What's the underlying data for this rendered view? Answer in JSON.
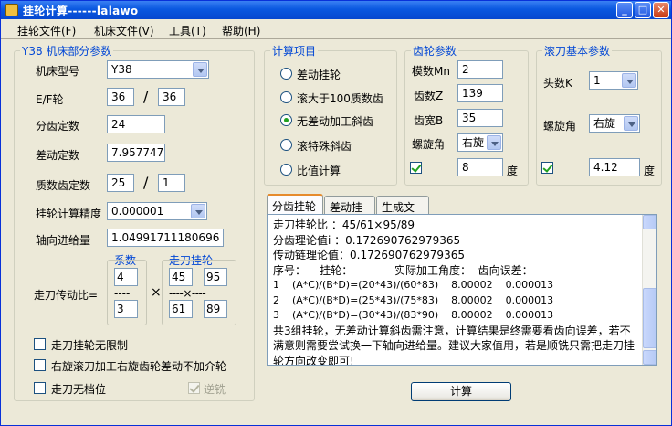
{
  "window": {
    "title": "挂轮计算------lalawo",
    "min_glyph": "_",
    "max_glyph": "□",
    "close_glyph": "✕"
  },
  "menu": {
    "items": [
      "挂轮文件(F)",
      "机床文件(V)",
      "工具(T)",
      "帮助(H)"
    ]
  },
  "machine": {
    "legend": "Y38 机床部分参数",
    "model_label": "机床型号",
    "model_value": "Y38",
    "ef_label": "E/F轮",
    "e_value": "36",
    "f_value": "36",
    "slash": "/",
    "indexing_const_label": "分齿定数",
    "indexing_const_value": "24",
    "diff_const_label": "差动定数",
    "diff_const_value": "7.957747",
    "prime_const_label": "质数齿定数",
    "prime_a_value": "25",
    "prime_b_value": "1",
    "precision_label": "挂轮计算精度",
    "precision_value": "0.000001",
    "axial_feed_label": "轴向进给量",
    "axial_feed_value": "1.04991711180696",
    "coef_title": "系数",
    "feed_gear_title": "走刀挂轮",
    "feed_ratio_label": "走刀传动比=",
    "coef_top": "4",
    "coef_sep": "----",
    "coef_bottom": "3",
    "times_sign": "×",
    "gear_a": "45",
    "gear_b": "95",
    "gear_c": "61",
    "gear_d": "89",
    "gear_sep": "----×----",
    "opt_no_limit": "走刀挂轮无限制",
    "opt_right_hob": "右旋滚刀加工右旋齿轮差动不加介轮",
    "opt_no_gear": "走刀无档位",
    "opt_climb": "逆铣"
  },
  "calc_items": {
    "legend": "计算项目",
    "options": [
      "差动挂轮",
      "滚大于100质数齿",
      "无差动加工斜齿",
      "滚特殊斜齿",
      "比值计算"
    ],
    "selected_index": 2
  },
  "gear": {
    "legend": "齿轮参数",
    "module_label": "模数Mn",
    "module_value": "2",
    "teeth_label": "齿数Z",
    "teeth_value": "139",
    "width_label": "齿宽B",
    "width_value": "35",
    "helix_label": "螺旋角",
    "helix_value": "右旋",
    "angle_value": "8",
    "degree_unit": "度"
  },
  "hob": {
    "legend": "滚刀基本参数",
    "starts_label": "头数K",
    "starts_value": "1",
    "helix_label": "螺旋角",
    "helix_value": "右旋",
    "angle_value": "4.12",
    "degree_unit": "度"
  },
  "tabs": [
    "分齿挂轮",
    "差动挂轮",
    "生成文件"
  ],
  "results": {
    "lines": [
      "走刀挂轮比 ：45/61×95/89",
      "分齿理论值i ：0.172690762979365",
      "传动链理论值：0.172690762979365",
      "序号：    挂轮：            实际加工角度：  齿向误差：",
      "1    (A*C)/(B*D)=(20*43)/(60*83)    8.00002    0.000013",
      "2    (A*C)/(B*D)=(25*43)/(75*83)    8.00002    0.000013",
      "3    (A*C)/(B*D)=(30*43)/(83*90)    8.00002    0.000013"
    ],
    "note": "共3组挂轮，无差动计算斜齿需注意，计算结果是终需要看齿向误差，若不满意则需要尝试换一下轴向进给量。建议大家值用，若是顺铣只需把走刀挂轮方向改变即可!"
  },
  "calc_button_label": "计算"
}
